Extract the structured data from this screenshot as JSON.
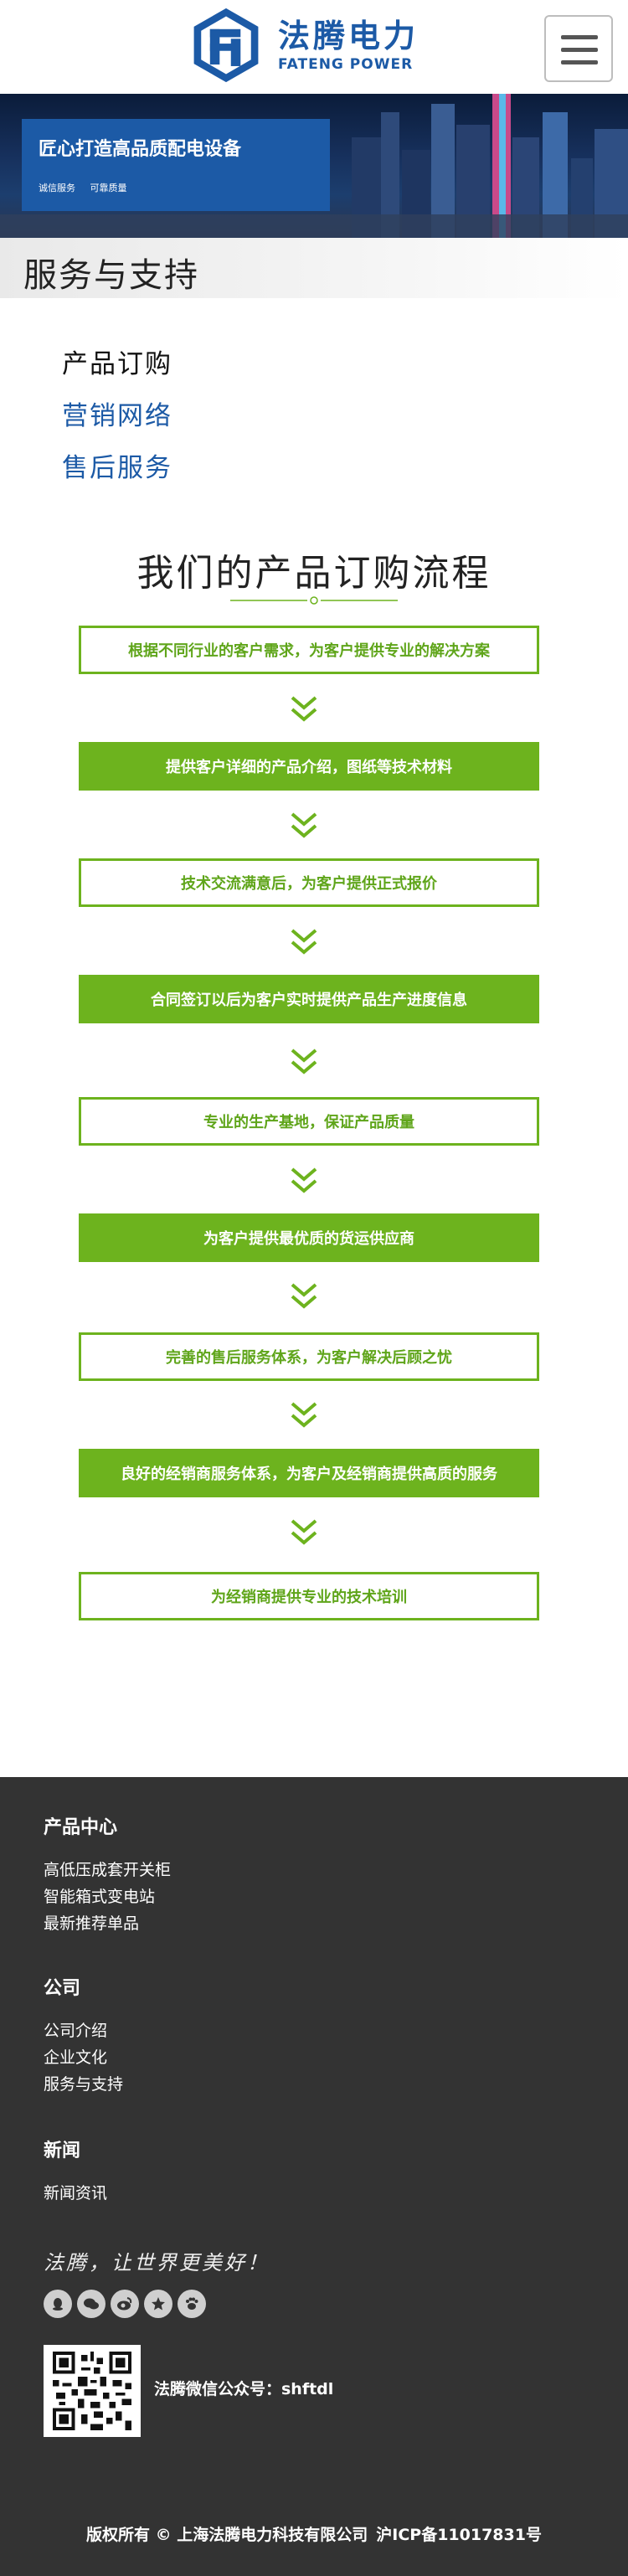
{
  "header": {
    "brand_cn": "法腾电力",
    "brand_en": "FATENG POWER",
    "brand_color": "#1c5aa6",
    "menu_icon": "hamburger-menu-icon"
  },
  "banner": {
    "title": "匠心打造高品质配电设备",
    "tags": [
      "诚信服务",
      "可靠质量"
    ]
  },
  "section": {
    "title": "服务与支持"
  },
  "subnav": {
    "items": [
      {
        "label": "产品订购",
        "state": "active"
      },
      {
        "label": "营销网络",
        "state": "link"
      },
      {
        "label": "售后服务",
        "state": "link"
      }
    ]
  },
  "process": {
    "title": "我们的产品订购流程",
    "accent": "#6db31e",
    "steps": [
      {
        "text": "根据不同行业的客户需求，为客户提供专业的解决方案",
        "style": "outline"
      },
      {
        "text": "提供客户详细的产品介绍，图纸等技术材料",
        "style": "filled"
      },
      {
        "text": "技术交流满意后，为客户提供正式报价",
        "style": "outline"
      },
      {
        "text": "合同签订以后为客户实时提供产品生产进度信息",
        "style": "filled"
      },
      {
        "text": "专业的生产基地，保证产品质量",
        "style": "outline"
      },
      {
        "text": "为客户提供最优质的货运供应商",
        "style": "filled"
      },
      {
        "text": "完善的售后服务体系，为客户解决后顾之忧",
        "style": "outline"
      },
      {
        "text": "良好的经销商服务体系，为客户及经销商提供高质的服务",
        "style": "filled"
      },
      {
        "text": "为经销商提供专业的技术培训",
        "style": "outline"
      }
    ]
  },
  "footer": {
    "background": "#333333",
    "groups": [
      {
        "heading": "产品中心",
        "links": [
          "高低压成套开关柜",
          "智能箱式变电站",
          "最新推荐单品"
        ]
      },
      {
        "heading": "公司",
        "links": [
          "公司介绍",
          "企业文化",
          "服务与支持"
        ]
      },
      {
        "heading": "新闻",
        "links": [
          "新闻资讯"
        ]
      }
    ],
    "slogan": "法腾，让世界更美好！",
    "social_icons": [
      "qq-icon",
      "wechat-icon",
      "weibo-icon",
      "star-icon",
      "paw-icon"
    ],
    "wechat_label": "法腾微信公众号：shftdl",
    "copyright": {
      "text": "版权所有 © 上海法腾电力科技有限公司",
      "icp": "沪ICP备11017831号"
    }
  }
}
